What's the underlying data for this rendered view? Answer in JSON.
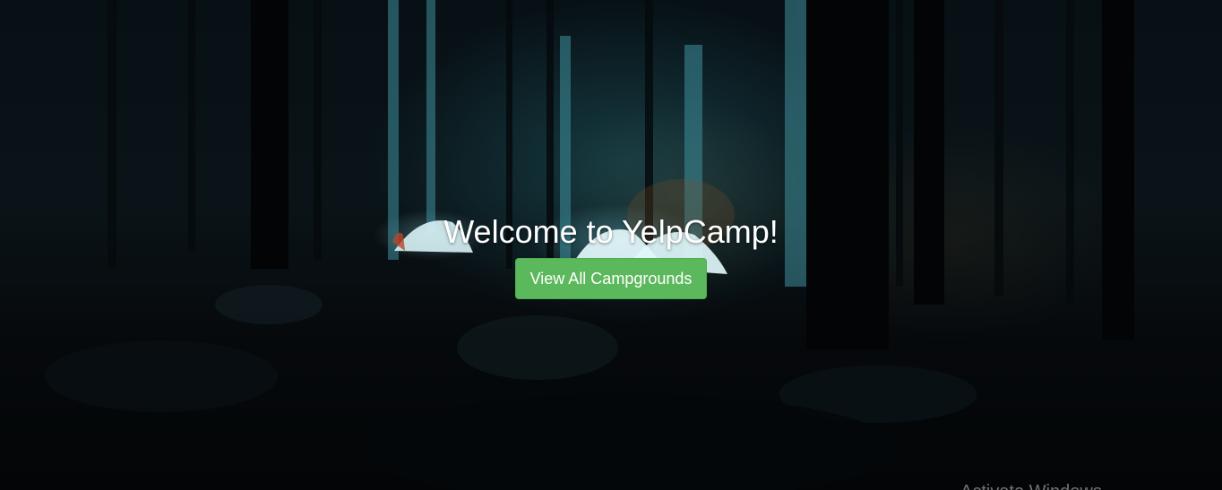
{
  "hero": {
    "title": "Welcome to YelpCamp!",
    "button_label": "View All Campgrounds",
    "button_color": "#5cb85c",
    "text_color": "#ffffff"
  },
  "background": {
    "image_name": "night-forest-campsite-photo"
  },
  "overlay": {
    "watermark_text": "Activate Windows"
  }
}
